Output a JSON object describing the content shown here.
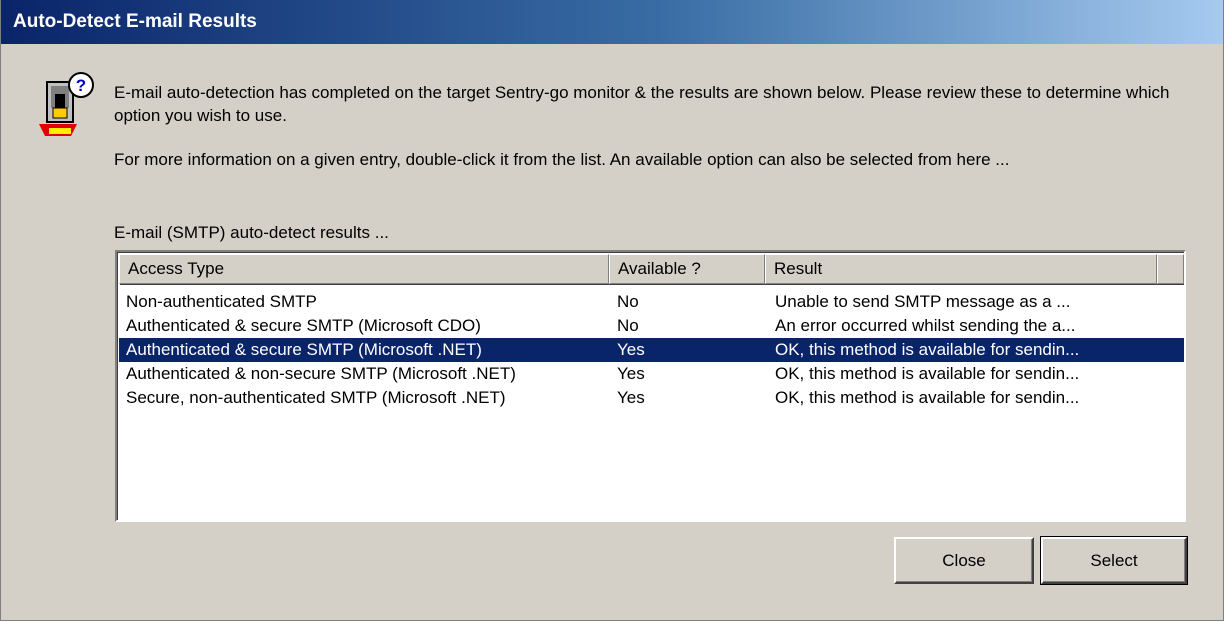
{
  "window": {
    "title": "Auto-Detect E-mail Results"
  },
  "intro": {
    "paragraph1": "E-mail auto-detection has completed on the target Sentry-go monitor & the results are shown below. Please review these to determine which option you wish to use.",
    "paragraph2": "For more information on a given entry, double-click it from the list. An available option can also be selected from here ...",
    "list_label": "E-mail (SMTP) auto-detect results ..."
  },
  "icon": {
    "name": "security-question-icon"
  },
  "list": {
    "columns": [
      "Access Type",
      "Available ?",
      "Result"
    ],
    "rows": [
      {
        "access": "Non-authenticated SMTP",
        "available": "No",
        "result": "Unable to send SMTP message as a ..."
      },
      {
        "access": "Authenticated & secure SMTP (Microsoft CDO)",
        "available": "No",
        "result": "An error occurred whilst sending the a..."
      },
      {
        "access": "Authenticated & secure SMTP (Microsoft .NET)",
        "available": "Yes",
        "result": "OK, this method is available for sendin..."
      },
      {
        "access": "Authenticated & non-secure SMTP (Microsoft .NET)",
        "available": "Yes",
        "result": "OK, this method is available for sendin..."
      },
      {
        "access": "Secure, non-authenticated SMTP (Microsoft .NET)",
        "available": "Yes",
        "result": "OK, this method is available for sendin..."
      }
    ],
    "selected_index": 2
  },
  "buttons": {
    "close": "Close",
    "select": "Select"
  },
  "colors": {
    "titlebar_start": "#0a246a",
    "titlebar_end": "#a6caf0",
    "selection": "#0a246a",
    "face": "#d4d0c8"
  }
}
